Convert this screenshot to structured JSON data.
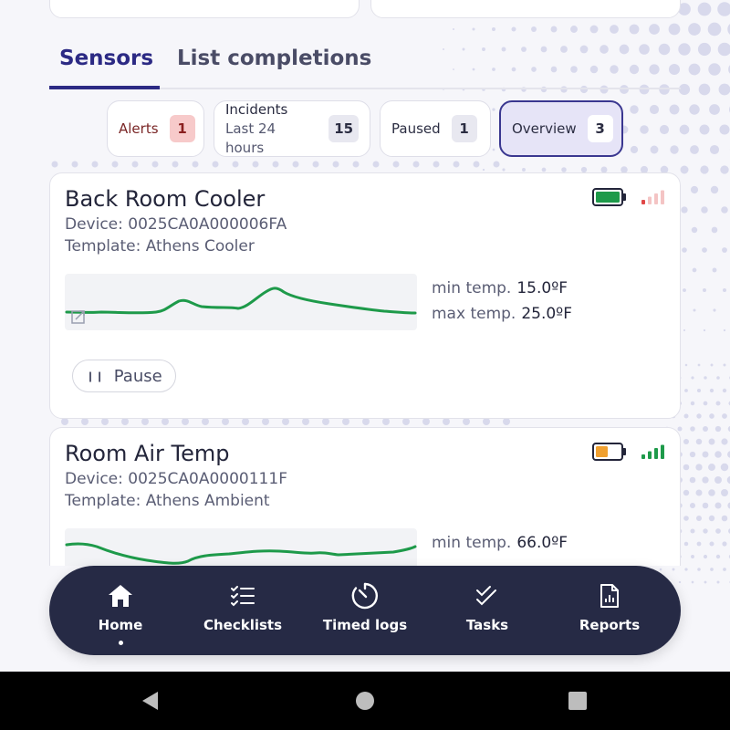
{
  "tabs": [
    {
      "label": "Sensors",
      "active": true
    },
    {
      "label": "List completions",
      "active": false
    }
  ],
  "filters": {
    "alerts": {
      "label": "Alerts",
      "count": "1"
    },
    "incidents": {
      "label": "Incidents",
      "sub": "Last 24 hours",
      "count": "15"
    },
    "paused": {
      "label": "Paused",
      "count": "1"
    },
    "overview": {
      "label": "Overview",
      "count": "3",
      "selected": true
    }
  },
  "sensors": [
    {
      "name": "Back Room Cooler",
      "device": "Device: 0025CA0A000006FA",
      "template": "Template: Athens Cooler",
      "min_label": "min temp.",
      "min_value": "15.0ºF",
      "max_label": "max temp.",
      "max_value": "25.0ºF",
      "battery_level": 1.0,
      "battery_color": "#1e9a4a",
      "signal_bars": 1,
      "signal_color": "#e04848",
      "pause_label": "Pause"
    },
    {
      "name": "Room Air Temp",
      "device": "Device: 0025CA0A0000111F",
      "template": "Template: Athens Ambient",
      "min_label": "min temp.",
      "min_value": "66.0ºF",
      "battery_level": 0.5,
      "battery_color": "#f0a030",
      "signal_bars": 4,
      "signal_color": "#1e9a4a"
    }
  ],
  "nav": [
    {
      "label": "Home",
      "icon": "home-icon",
      "active": true
    },
    {
      "label": "Checklists",
      "icon": "checklist-icon"
    },
    {
      "label": "Timed logs",
      "icon": "timer-icon"
    },
    {
      "label": "Tasks",
      "icon": "tasks-check-icon"
    },
    {
      "label": "Reports",
      "icon": "report-icon"
    }
  ],
  "colors": {
    "accent": "#2c2a84",
    "nav_bg": "#262a45",
    "line": "#1e9a4a"
  }
}
